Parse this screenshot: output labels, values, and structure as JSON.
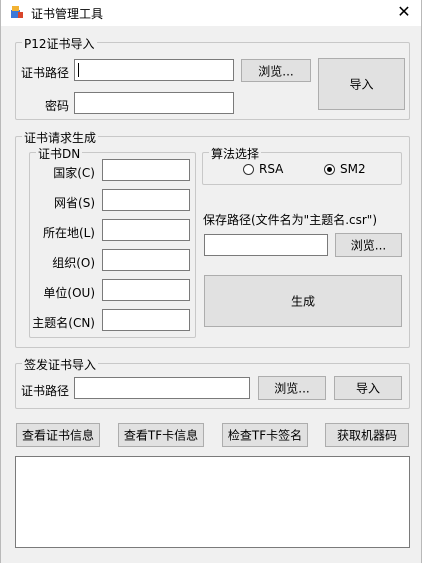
{
  "window": {
    "title": "证书管理工具",
    "close_glyph": "✕"
  },
  "p12": {
    "group_label": "P12证书导入",
    "path_label": "证书路径",
    "path_value": "",
    "password_label": "密码",
    "password_value": "",
    "browse_label": "浏览...",
    "import_label": "导入"
  },
  "csr": {
    "group_label": "证书请求生成",
    "dn": {
      "group_label": "证书DN",
      "fields": [
        {
          "label": "国家(C)",
          "value": ""
        },
        {
          "label": "网省(S)",
          "value": ""
        },
        {
          "label": "所在地(L)",
          "value": ""
        },
        {
          "label": "组织(O)",
          "value": ""
        },
        {
          "label": "单位(OU)",
          "value": ""
        },
        {
          "label": "主题名(CN)",
          "value": ""
        }
      ]
    },
    "algo": {
      "group_label": "算法选择",
      "options": [
        {
          "label": "RSA",
          "selected": false
        },
        {
          "label": "SM2",
          "selected": true
        }
      ]
    },
    "save_label": "保存路径(文件名为\"主题名.csr\")",
    "save_value": "",
    "browse_label": "浏览...",
    "generate_label": "生成"
  },
  "signed": {
    "group_label": "签发证书导入",
    "path_label": "证书路径",
    "path_value": "",
    "browse_label": "浏览...",
    "import_label": "导入"
  },
  "actions": {
    "view_cert": "查看证书信息",
    "view_tf": "查看TF卡信息",
    "check_tf": "检查TF卡签名",
    "get_machine": "获取机器码"
  },
  "output": {
    "value": ""
  },
  "icons": {
    "app": "certificate-app-icon",
    "close": "close-icon"
  }
}
